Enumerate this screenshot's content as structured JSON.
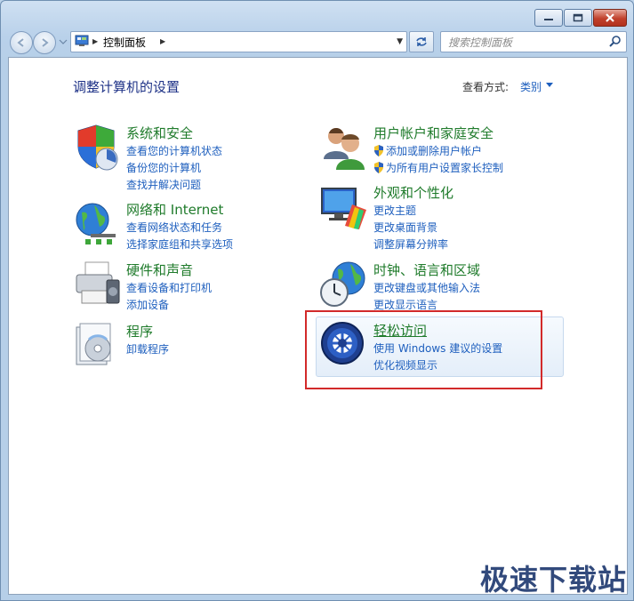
{
  "window": {
    "minimize_icon": "minimize-icon",
    "maximize_icon": "maximize-icon",
    "close_icon": "close-icon"
  },
  "nav": {
    "address_path": "控制面板",
    "search_placeholder": "搜索控制面板"
  },
  "header": {
    "title": "调整计算机的设置",
    "view_by_label": "查看方式:",
    "view_by_value": "类别"
  },
  "categories": [
    {
      "title": "系统和安全",
      "icon": "shield-icon",
      "links": [
        "查看您的计算机状态",
        "备份您的计算机",
        "查找并解决问题"
      ]
    },
    {
      "title": "网络和 Internet",
      "icon": "network-icon",
      "links": [
        "查看网络状态和任务",
        "选择家庭组和共享选项"
      ]
    },
    {
      "title": "硬件和声音",
      "icon": "printer-icon",
      "links": [
        "查看设备和打印机",
        "添加设备"
      ]
    },
    {
      "title": "程序",
      "icon": "programs-icon",
      "links": [
        "卸载程序"
      ]
    },
    {
      "title": "用户帐户和家庭安全",
      "icon": "users-icon",
      "links": [
        "添加或删除用户帐户",
        "为所有用户设置家长控制"
      ]
    },
    {
      "title": "外观和个性化",
      "icon": "appearance-icon",
      "links": [
        "更改主题",
        "更改桌面背景",
        "调整屏幕分辨率"
      ]
    },
    {
      "title": "时钟、语言和区域",
      "icon": "clock-globe-icon",
      "links": [
        "更改键盘或其他输入法",
        "更改显示语言"
      ]
    },
    {
      "title": "轻松访问",
      "icon": "ease-of-access-icon",
      "links": [
        "使用 Windows 建议的设置",
        "优化视频显示"
      ]
    }
  ],
  "watermark": "极速下载站",
  "colors": {
    "category_title": "#1f7b2b",
    "link": "#1e5fbe",
    "highlight": "#d22a2a"
  }
}
